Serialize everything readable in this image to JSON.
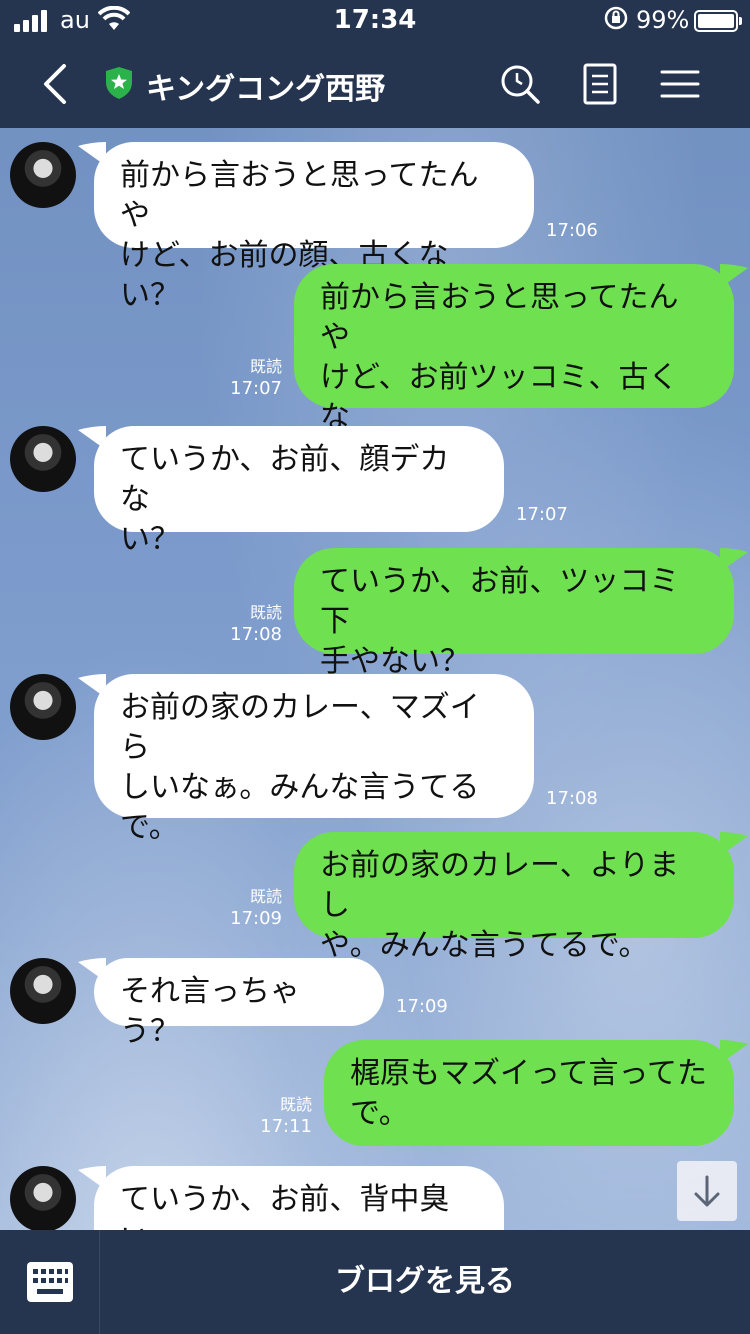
{
  "status": {
    "carrier": "au",
    "time": "17:34",
    "battery": "99%"
  },
  "header": {
    "title": "キングコング西野"
  },
  "messages": [
    {
      "text": "前から言おうと思ってたんや\nけど、お前の顔、古くない？",
      "time": "17:06"
    },
    {
      "text": "前から言おうと思ってたんや\nけど、お前ツッコミ、古くな\nい？",
      "read": "既読",
      "time": "17:07"
    },
    {
      "text": "ていうか、お前、顔デカな\nい？",
      "time": "17:07"
    },
    {
      "text": "ていうか、お前、ツッコミ下\n手やない？",
      "read": "既読",
      "time": "17:08"
    },
    {
      "text": "お前の家のカレー、マズイら\nしいなぁ。みんな言うてる\nで。",
      "time": "17:08"
    },
    {
      "text": "お前の家のカレー、よりまし\nや。みんな言うてるで。",
      "read": "既読",
      "time": "17:09"
    },
    {
      "text": "それ言っちゃう？",
      "time": "17:09"
    },
    {
      "text": "梶原もマズイって言ってた\nで。",
      "read": "既読",
      "time": "17:11"
    },
    {
      "text": "ていうか、お前、背中臭い"
    }
  ],
  "bottom": {
    "blog_label": "ブログを見る"
  }
}
